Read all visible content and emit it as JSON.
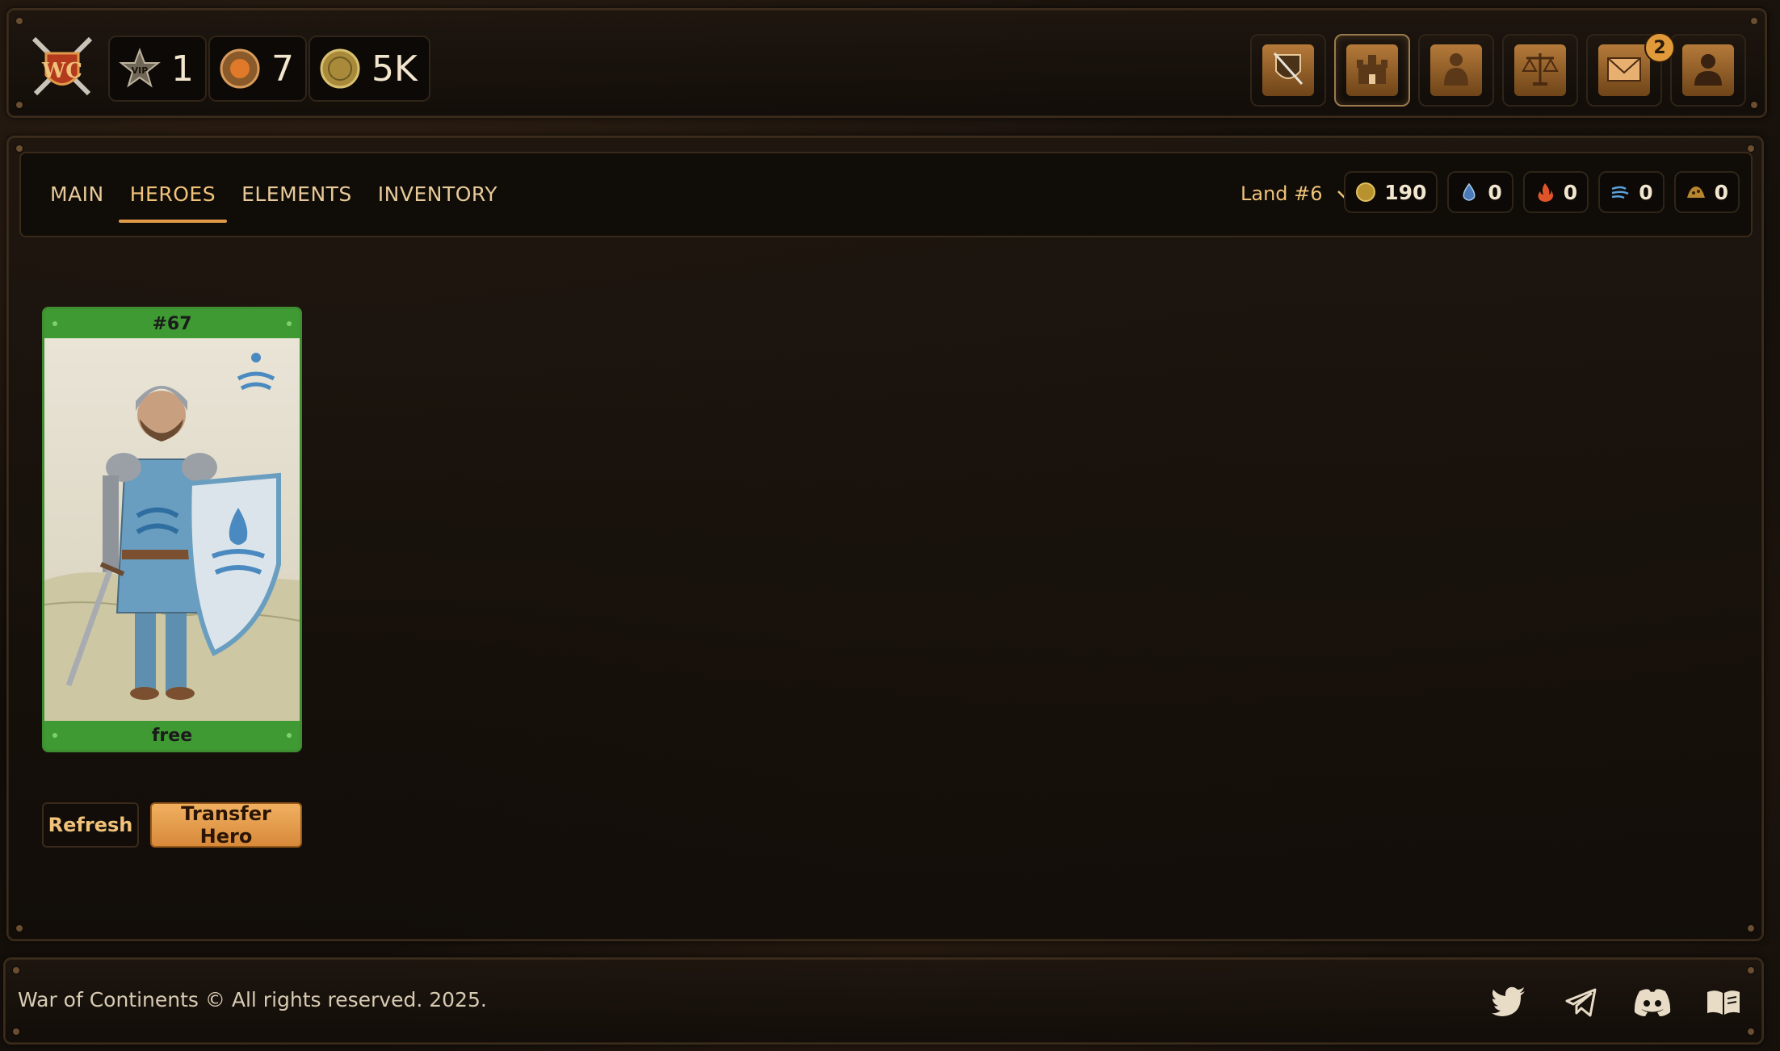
{
  "header": {
    "logo_icon": "crossed-swords-shield-icon",
    "stats": [
      {
        "name": "vip",
        "icon": "vip-star-icon",
        "value": "1"
      },
      {
        "name": "medal",
        "icon": "bronze-medal-icon",
        "value": "7"
      },
      {
        "name": "gold",
        "icon": "gold-coin-icon",
        "value": "5K"
      }
    ],
    "nav": [
      {
        "name": "battle",
        "icon": "sword-shield-icon"
      },
      {
        "name": "castle",
        "icon": "castle-icon",
        "active": true
      },
      {
        "name": "heroes",
        "icon": "knight-icon"
      },
      {
        "name": "market",
        "icon": "scales-icon"
      },
      {
        "name": "mail",
        "icon": "envelope-icon",
        "badge": "2"
      },
      {
        "name": "profile",
        "icon": "profile-silhouette-icon"
      }
    ]
  },
  "tabs": [
    {
      "label": "MAIN"
    },
    {
      "label": "HEROES",
      "active": true
    },
    {
      "label": "ELEMENTS"
    },
    {
      "label": "INVENTORY"
    }
  ],
  "land_selector": {
    "label": "Land #6"
  },
  "resources": [
    {
      "icon": "gold-coin-icon",
      "value": "190"
    },
    {
      "icon": "water-element-icon",
      "value": "0"
    },
    {
      "icon": "fire-element-icon",
      "value": "0"
    },
    {
      "icon": "wind-element-icon",
      "value": "0"
    },
    {
      "icon": "earth-element-icon",
      "value": "0"
    }
  ],
  "hero_card": {
    "id": "#67",
    "status": "free",
    "element_icon": "water-element-icon"
  },
  "buttons": {
    "refresh": "Refresh",
    "transfer": "Transfer Hero"
  },
  "footer": {
    "copyright": "War of Continents © All rights reserved. 2025.",
    "social": [
      "twitter-icon",
      "telegram-icon",
      "discord-icon",
      "book-icon"
    ]
  },
  "colors": {
    "accent": "#e09a4a",
    "card_green": "#3f9a33",
    "gold_text": "#f0c27a"
  }
}
